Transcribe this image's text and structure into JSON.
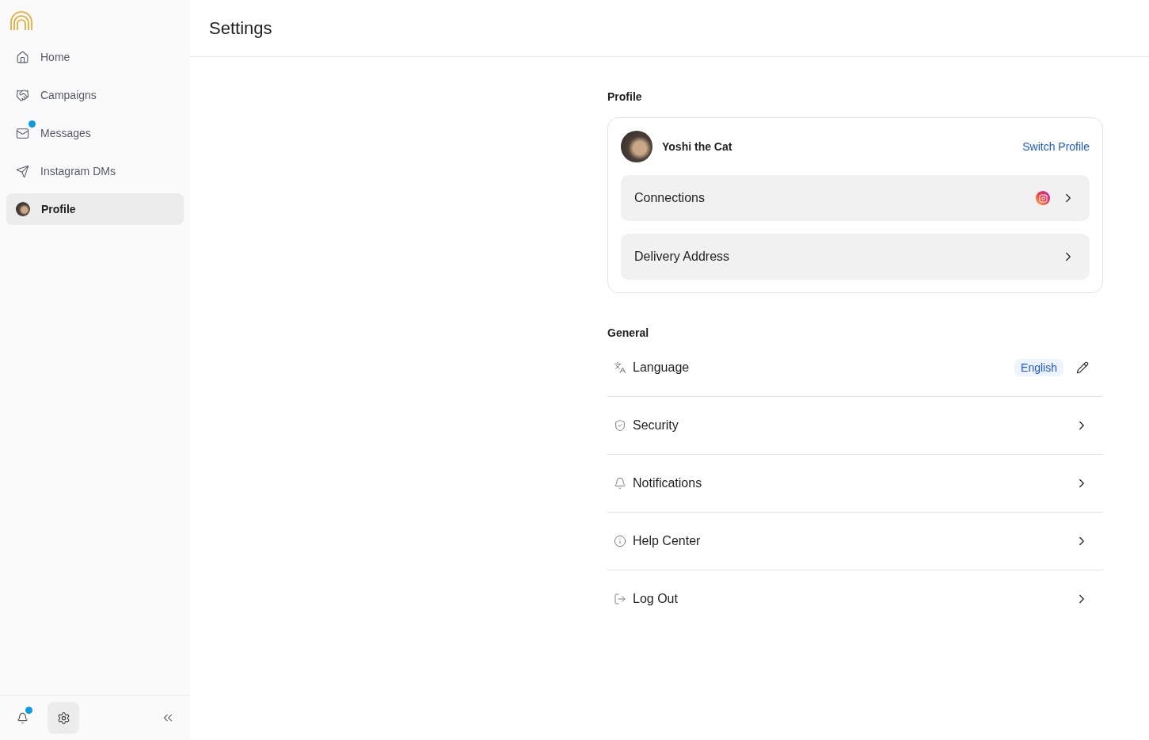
{
  "sidebar": {
    "items": [
      {
        "label": "Home",
        "kind": "icon",
        "selected": false,
        "unread": false
      },
      {
        "label": "Campaigns",
        "kind": "icon",
        "selected": false,
        "unread": false
      },
      {
        "label": "Messages",
        "kind": "icon",
        "selected": false,
        "unread": true
      },
      {
        "label": "Instagram DMs",
        "kind": "icon",
        "selected": false,
        "unread": false
      },
      {
        "label": "Profile",
        "kind": "avatar",
        "selected": true,
        "unread": false
      }
    ],
    "footer": {
      "notifications_unread": true,
      "settings_selected": true
    }
  },
  "header": {
    "title": "Settings"
  },
  "profile": {
    "heading": "Profile",
    "name": "Yoshi the Cat",
    "switch_link": "Switch Profile",
    "rows": [
      {
        "label": "Connections",
        "instagram_connected": true
      },
      {
        "label": "Delivery Address",
        "instagram_connected": false
      }
    ]
  },
  "general": {
    "heading": "General",
    "rows": [
      {
        "label": "Language",
        "kind": "value",
        "value": "English"
      },
      {
        "label": "Security",
        "kind": "link"
      },
      {
        "label": "Notifications",
        "kind": "link"
      },
      {
        "label": "Help Center",
        "kind": "link"
      },
      {
        "label": "Log Out",
        "kind": "link"
      }
    ]
  }
}
